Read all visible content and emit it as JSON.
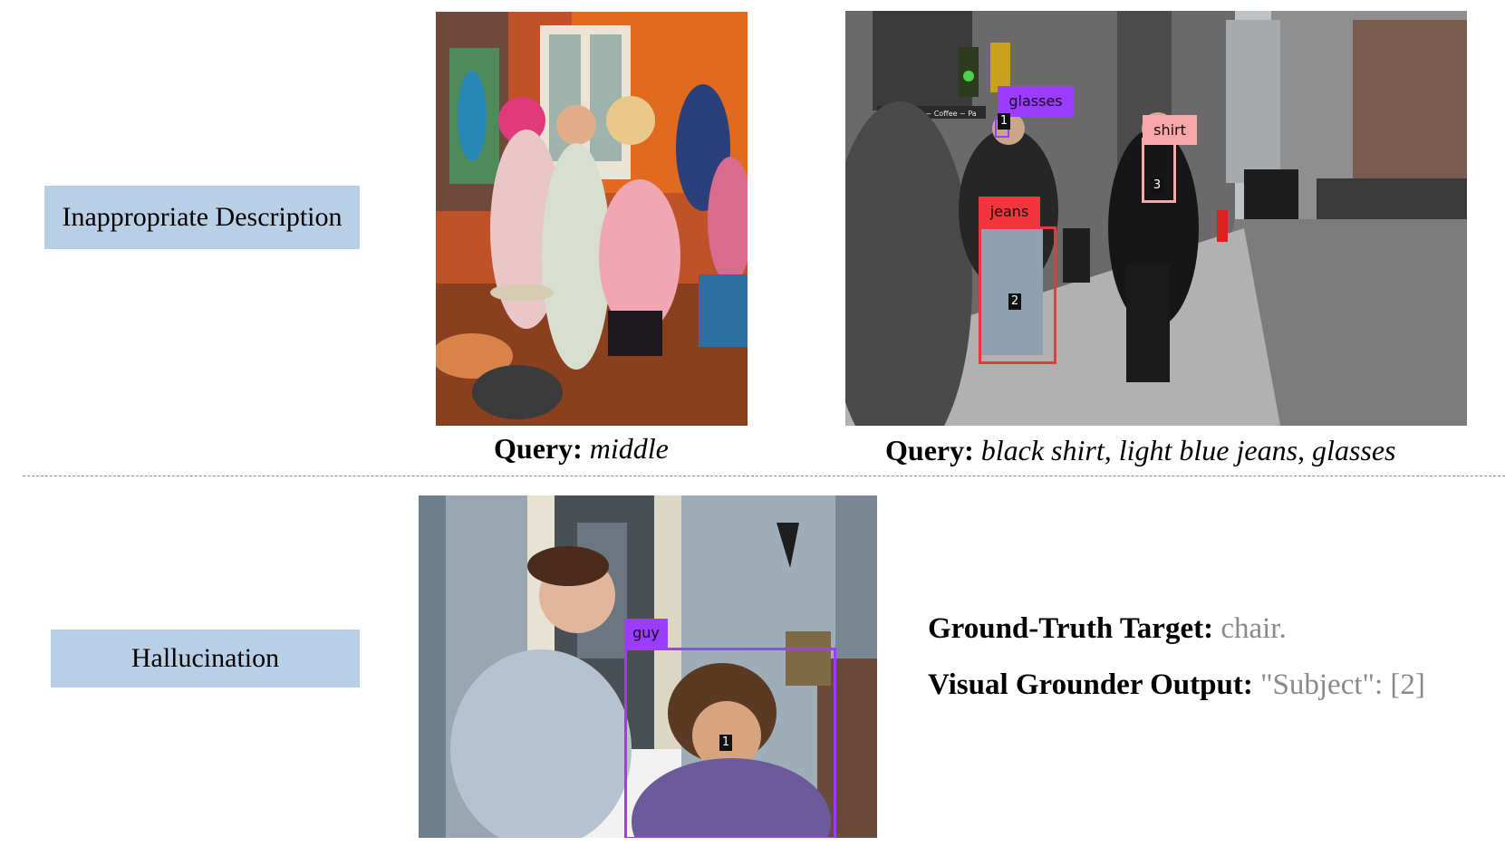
{
  "categories": {
    "top": "Inappropriate Description",
    "bottom": "Hallucination"
  },
  "queries": {
    "left": {
      "label": "Query:",
      "text": "middle"
    },
    "right": {
      "label": "Query:",
      "text": "black shirt, light blue jeans, glasses"
    }
  },
  "street_photo": {
    "boxes": [
      {
        "tag": "glasses",
        "index": "1"
      },
      {
        "tag": "jeans",
        "index": "2"
      },
      {
        "tag": "shirt",
        "index": "3"
      }
    ],
    "sign_text": "Gift Baskets ~ Coffee ~ Pa"
  },
  "porch_photo": {
    "boxes": [
      {
        "tag": "guy",
        "index": "1"
      }
    ]
  },
  "result": {
    "gt_label": "Ground-Truth Target:",
    "gt_value": "chair.",
    "out_label": "Visual Grounder Output:",
    "out_value": "\"Subject\":  [2]"
  },
  "colors": {
    "category_box": "#b8cfe6",
    "glasses_box": "#9b3dff",
    "jeans_box": "#f0363c",
    "shirt_box": "#f7a7aa",
    "guy_box": "#9b3dff",
    "divider": "#6f8fc4"
  }
}
